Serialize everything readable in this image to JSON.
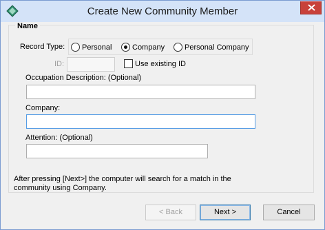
{
  "window": {
    "title": "Create New Community Member",
    "icon": "diamond-app-icon"
  },
  "group": {
    "title": "Name"
  },
  "record_type": {
    "label": "Record Type:",
    "options": [
      {
        "label": "Personal",
        "checked": false
      },
      {
        "label": "Company",
        "checked": true
      },
      {
        "label": "Personal Company",
        "checked": false
      }
    ]
  },
  "id_field": {
    "label": "ID:",
    "value": "",
    "use_existing_label": "Use existing ID",
    "use_existing_checked": false
  },
  "occupation": {
    "label": "Occupation Description: (Optional)",
    "value": ""
  },
  "company": {
    "label": "Company:",
    "value": ""
  },
  "attention": {
    "label": "Attention:  (Optional)",
    "value": ""
  },
  "note": {
    "text": "After pressing [Next>] the computer will search for a match in the community using Company."
  },
  "buttons": {
    "back": "< Back",
    "next": "Next >",
    "cancel": "Cancel"
  },
  "colors": {
    "titlebar": "#d4e3f8",
    "close": "#c8413a",
    "focus_border": "#569de5"
  }
}
